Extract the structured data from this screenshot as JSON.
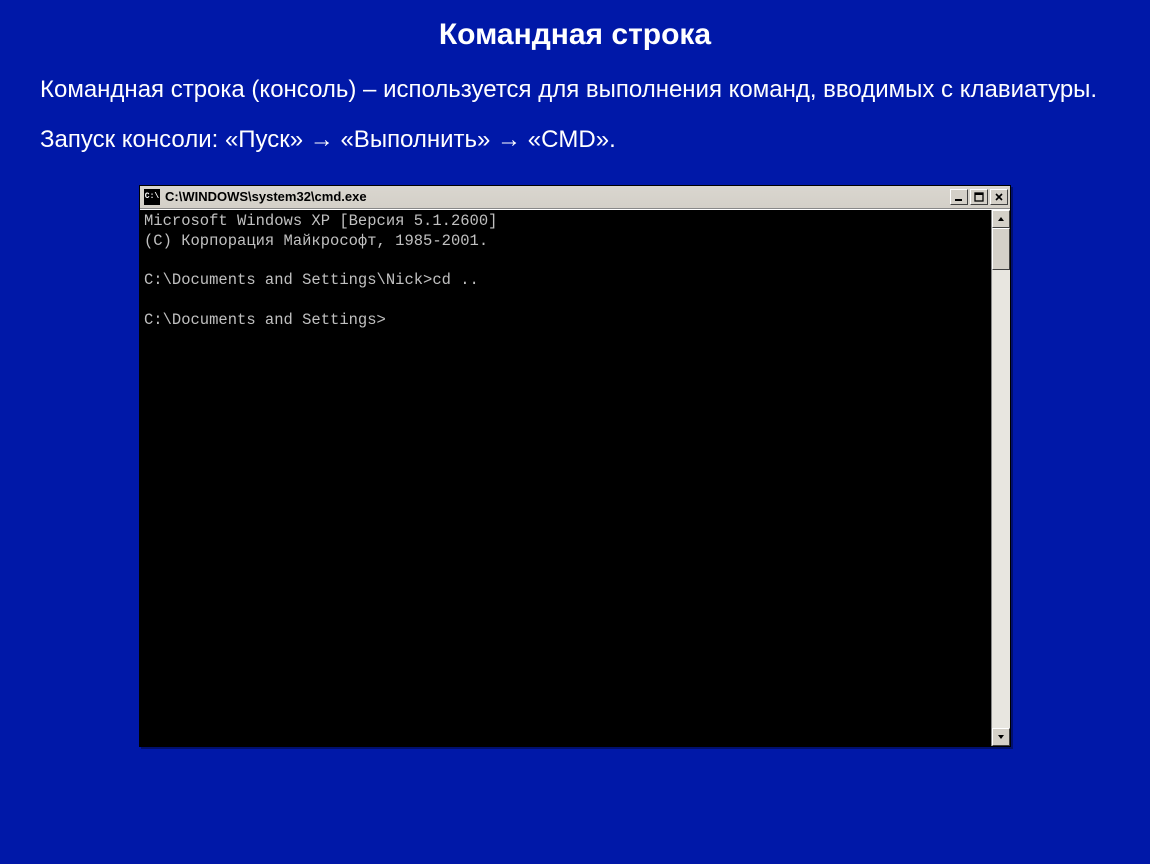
{
  "slide": {
    "title": "Командная строка",
    "para1": "Командная строка (консоль) – используется для выполнения команд, вводимых с клавиатуры.",
    "para2": "Запуск консоли: «Пуск» → «Выполнить» → «CMD»."
  },
  "cmd": {
    "title": "C:\\WINDOWS\\system32\\cmd.exe",
    "icon_text": "C:\\",
    "lines": {
      "l1": "Microsoft Windows XP [Версия 5.1.2600]",
      "l2": "(С) Корпорация Майкрософт, 1985-2001.",
      "l3": "",
      "l4": "C:\\Documents and Settings\\Nick>cd ..",
      "l5": "",
      "l6": "C:\\Documents and Settings>"
    }
  }
}
